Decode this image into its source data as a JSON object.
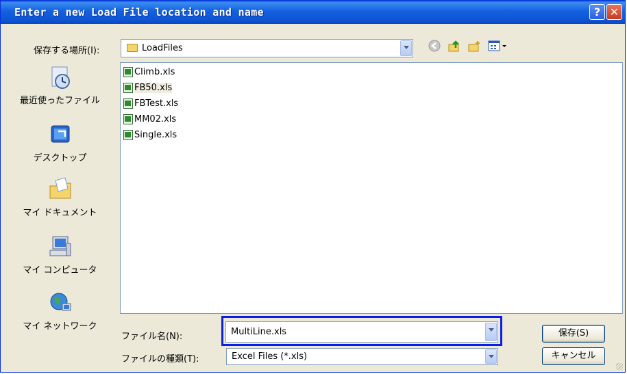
{
  "window": {
    "title": "Enter a new Load File location and name",
    "help_glyph": "?",
    "close_glyph": "✕"
  },
  "lookin": {
    "label": "保存する場所(I):",
    "value": "LoadFiles"
  },
  "toolbar": {
    "back_icon": "back-icon",
    "up_icon": "up-folder-icon",
    "new_folder_icon": "new-folder-icon",
    "view_icon": "view-menu-icon"
  },
  "places": [
    {
      "label": "最近使ったファイル",
      "icon": "recent-files-icon"
    },
    {
      "label": "デスクトップ",
      "icon": "desktop-icon"
    },
    {
      "label": "マイ ドキュメント",
      "icon": "my-documents-icon"
    },
    {
      "label": "マイ コンピュータ",
      "icon": "my-computer-icon"
    },
    {
      "label": "マイ ネットワーク",
      "icon": "my-network-icon"
    }
  ],
  "files": [
    {
      "name": "Climb.xls"
    },
    {
      "name": "FB50.xls"
    },
    {
      "name": "FBTest.xls"
    },
    {
      "name": "MM02.xls"
    },
    {
      "name": "Single.xls"
    }
  ],
  "filename": {
    "label": "ファイル名(N):",
    "value": "MultiLine.xls"
  },
  "filetype": {
    "label": "ファイルの種類(T):",
    "value": "Excel Files (*.xls)"
  },
  "buttons": {
    "save": "保存(S)",
    "cancel": "キャンセル"
  },
  "colors": {
    "titlebar": "#0b5ad8",
    "dialog_bg": "#ece9d8",
    "highlight": "#0a1ee8"
  }
}
